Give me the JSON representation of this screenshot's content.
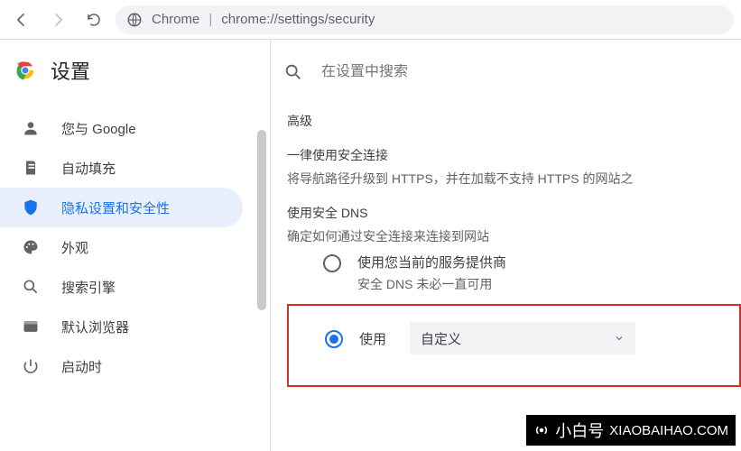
{
  "toolbar": {
    "protocol_label": "Chrome",
    "url": "chrome://settings/security"
  },
  "sidebar": {
    "title": "设置",
    "items": [
      {
        "label": "您与 Google"
      },
      {
        "label": "自动填充"
      },
      {
        "label": "隐私设置和安全性"
      },
      {
        "label": "外观"
      },
      {
        "label": "搜索引擎"
      },
      {
        "label": "默认浏览器"
      },
      {
        "label": "启动时"
      }
    ]
  },
  "search": {
    "placeholder": "在设置中搜索"
  },
  "main": {
    "advanced_title": "高级",
    "https": {
      "title": "一律使用安全连接",
      "desc": "将导航路径升级到 HTTPS，并在加载不支持 HTTPS 的网站之"
    },
    "dns": {
      "title": "使用安全 DNS",
      "desc": "确定如何通过安全连接来连接到网站",
      "option_current": {
        "label": "使用您当前的服务提供商",
        "sub": "安全 DNS 未必一直可用"
      },
      "option_custom": {
        "label": "使用",
        "dropdown": "自定义"
      }
    }
  },
  "watermark": {
    "cn": "小白号",
    "en": "XIAOBAIHAO.COM"
  }
}
